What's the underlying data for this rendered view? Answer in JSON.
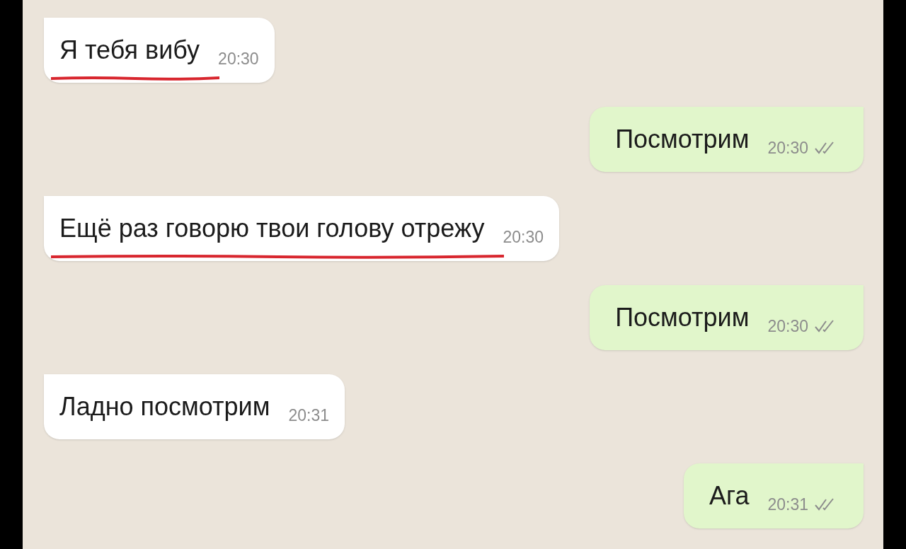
{
  "messages": [
    {
      "kind": "incoming",
      "text": "Я тебя вибу",
      "time": "20:30",
      "underlined": true
    },
    {
      "kind": "outgoing",
      "text": "Посмотрим",
      "time": "20:30",
      "read": false
    },
    {
      "kind": "incoming",
      "text": "Ещё раз говорю твои голову отрежу",
      "time": "20:30",
      "underlined": true
    },
    {
      "kind": "outgoing",
      "text": "Посмотрим",
      "time": "20:30",
      "read": false
    },
    {
      "kind": "incoming",
      "text": "Ладно посмотрим",
      "time": "20:31",
      "underlined": false
    },
    {
      "kind": "outgoing",
      "text": "Ага",
      "time": "20:31",
      "read": false
    }
  ]
}
